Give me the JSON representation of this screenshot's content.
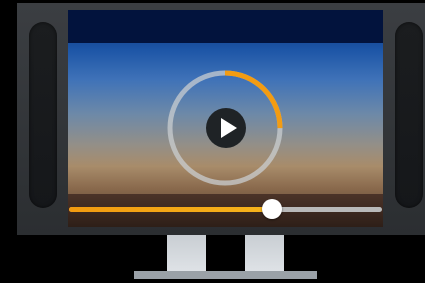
{
  "player": {
    "state": "paused",
    "control_icon": "play-icon",
    "ring_progress": 0.25,
    "seek_progress": 0.65
  },
  "colors": {
    "accent": "#f39c12",
    "ring_track": "#c9cdd0",
    "play_bg": "#1f2326",
    "monitor_frame": "#34373a",
    "stand": "#d5dadf"
  }
}
